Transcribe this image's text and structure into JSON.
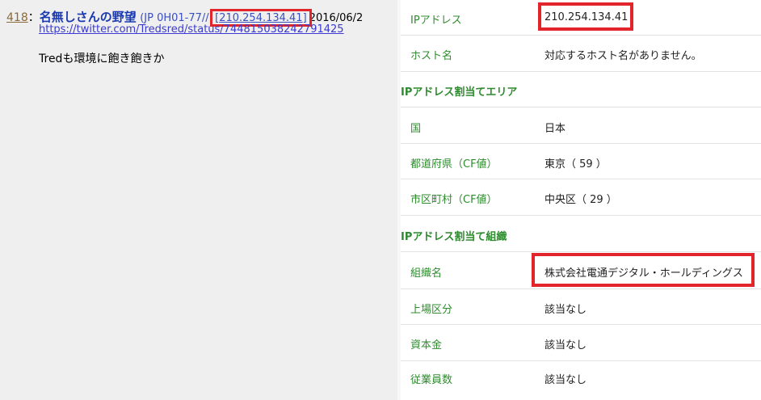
{
  "post": {
    "number": "418",
    "separator": "：",
    "name": "名無しさんの野望",
    "trip": "(JP 0H01-77//",
    "ip_open": "[",
    "ip": "210.254.134.41",
    "ip_close": "]",
    "date": "2016/06/2",
    "link": "https://twitter.com/Tredsred/status/744815038242791425",
    "body": "Tredも環境に飽き飽きか"
  },
  "ip_info": {
    "rows_top": [
      {
        "label": "IPアドレス",
        "value": "210.254.134.41"
      },
      {
        "label": "ホスト名",
        "value": "対応するホスト名がありません。"
      }
    ],
    "section_area": "IPアドレス割当てエリア",
    "rows_area": [
      {
        "label": "国",
        "value": "日本"
      },
      {
        "label": "都道府県（CF値）",
        "value": "東京（ 59 ）"
      },
      {
        "label": "市区町村（CF値）",
        "value": "中央区（ 29 ）"
      }
    ],
    "section_org": "IPアドレス割当て組織",
    "rows_org": [
      {
        "label": "組織名",
        "value": "株式会社電通デジタル・ホールディングス"
      },
      {
        "label": "上場区分",
        "value": "該当なし"
      },
      {
        "label": "資本金",
        "value": "該当なし"
      },
      {
        "label": "従業員数",
        "value": "該当なし"
      }
    ]
  },
  "colors": {
    "label_green": "#2e8b2e",
    "highlight_red": "#e1252a",
    "link_blue": "#3a7ab8"
  }
}
